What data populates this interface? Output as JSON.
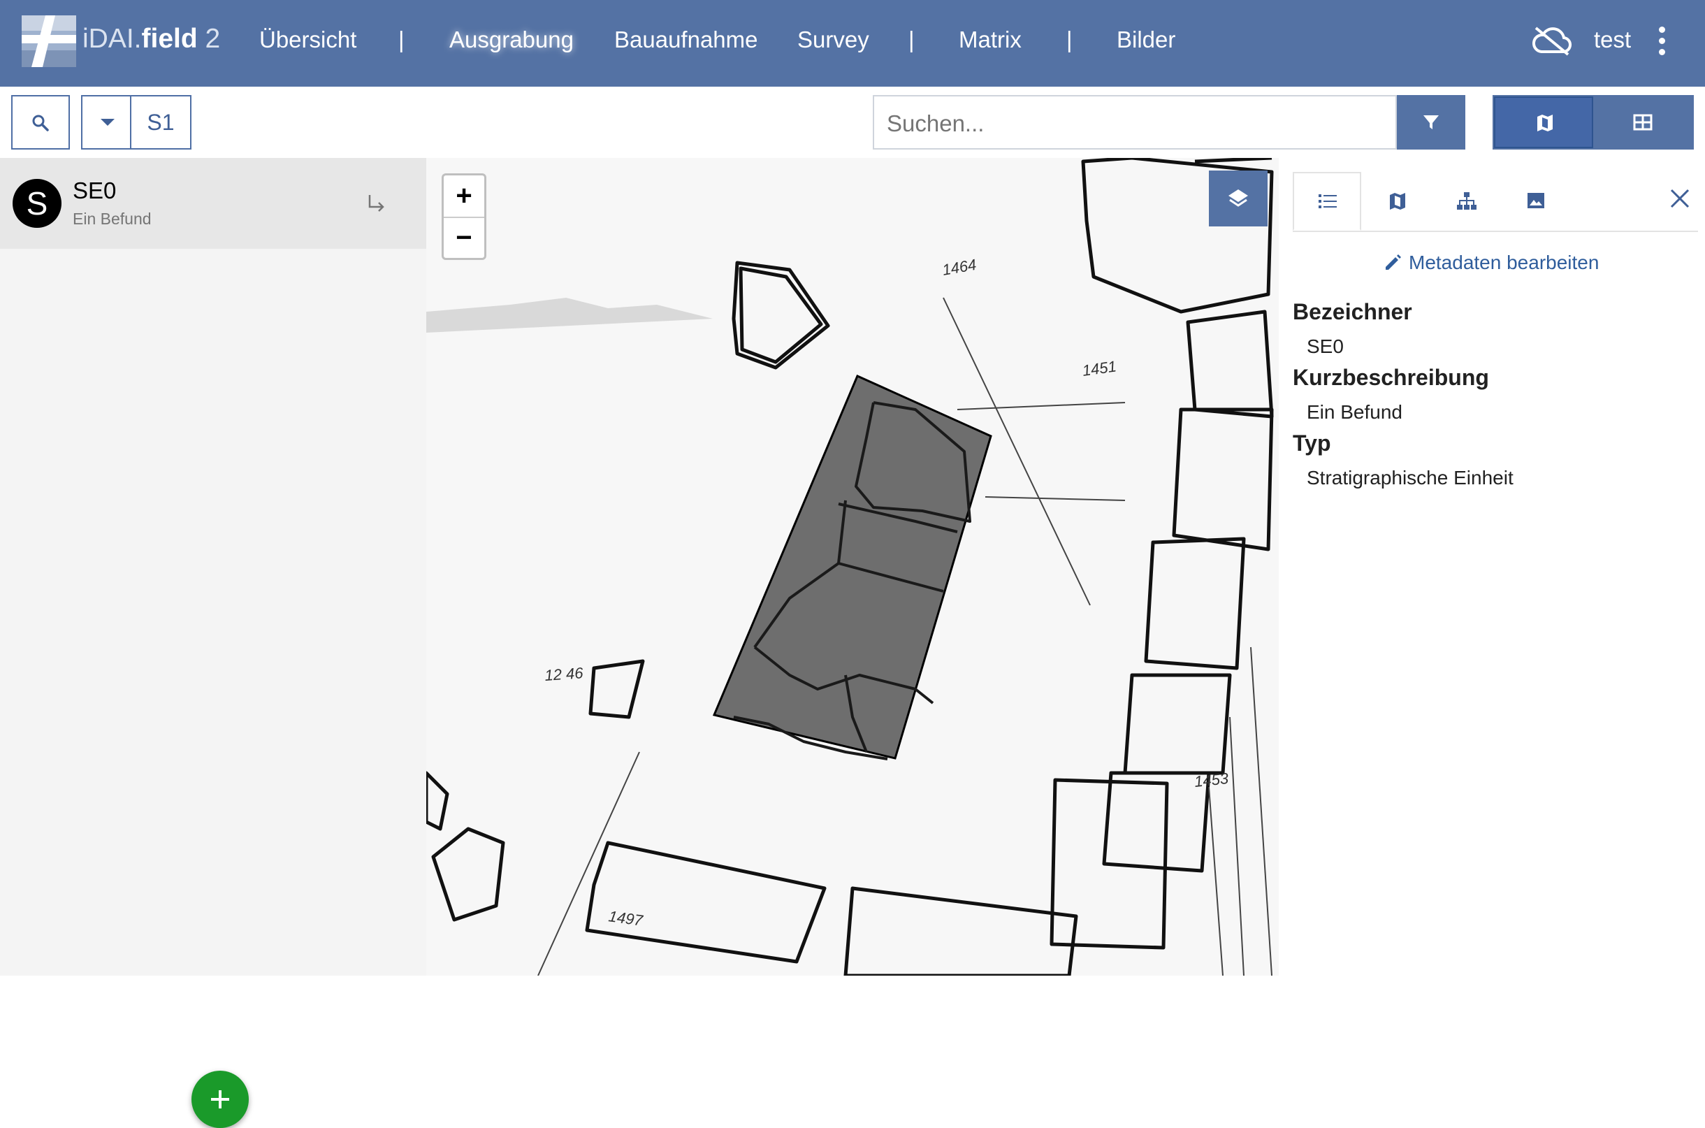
{
  "navbar": {
    "brand_a": "iDAI.",
    "brand_b": "field",
    "brand_c": "2",
    "items": [
      {
        "label": "Übersicht"
      },
      {
        "label": "Ausgrabung"
      },
      {
        "label": "Bauaufnahme"
      },
      {
        "label": "Survey"
      },
      {
        "label": "Matrix"
      },
      {
        "label": "Bilder"
      }
    ],
    "separator": "|",
    "active_item": "Ausgrabung",
    "user": "test",
    "sync_icon": "cloud-off-icon",
    "menu_icon": "more-vert-icon"
  },
  "toolbar": {
    "search_toggle_icon": "search-icon",
    "dropdown_icon": "caret-down-icon",
    "operation_label": "S1",
    "search_placeholder": "Suchen...",
    "filter_icon": "filter-icon",
    "view_modes": [
      {
        "icon": "map-icon",
        "active": true
      },
      {
        "icon": "table-icon",
        "active": false
      }
    ]
  },
  "resource_list": {
    "items": [
      {
        "avatar_letter": "S",
        "identifier": "SE0",
        "short_description": "Ein Befund",
        "action_icon": "move-into-icon"
      }
    ],
    "create_button_icon": "plus-icon"
  },
  "map": {
    "zoom_in_label": "+",
    "zoom_out_label": "−",
    "layers_icon": "layers-icon"
  },
  "sidebar": {
    "tabs": [
      {
        "icon": "list-icon",
        "active": true
      },
      {
        "icon": "map-icon",
        "active": false
      },
      {
        "icon": "hierarchy-icon",
        "active": false
      },
      {
        "icon": "image-icon",
        "active": false
      }
    ],
    "close_icon": "close-icon",
    "edit_metadata_label": "Metadaten bearbeiten",
    "fields": [
      {
        "label": "Bezeichner",
        "value": "SE0"
      },
      {
        "label": "Kurzbeschreibung",
        "value": "Ein Befund"
      },
      {
        "label": "Typ",
        "value": "Stratigraphische Einheit"
      }
    ]
  },
  "colors": {
    "navbar": "#5472a4",
    "primary": "#5472a4",
    "fab": "#1a9a2a",
    "link": "#2f5d9c"
  }
}
